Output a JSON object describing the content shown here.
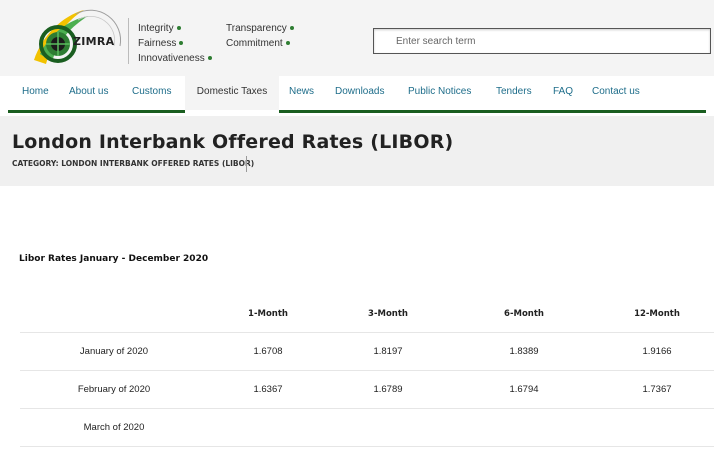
{
  "header": {
    "logo_text": "ZIMRA",
    "values_col1": [
      "Integrity",
      "Fairness",
      "Innovativeness"
    ],
    "values_col2": [
      "Transparency",
      "Commitment"
    ],
    "search_placeholder": "Enter search term",
    "brand_colors": {
      "green": "#2e7d32",
      "dark_green": "#1a5e20",
      "gold": "#f2c200",
      "link_blue": "#1e6d8a"
    }
  },
  "nav": {
    "items": [
      "Home",
      "About us",
      "Customs",
      "Domestic Taxes",
      "News",
      "Downloads",
      "Public Notices",
      "Tenders",
      "FAQ",
      "Contact us"
    ],
    "active": "Domestic Taxes"
  },
  "page": {
    "title": "London Interbank Offered Rates (LIBOR)",
    "category": "CATEGORY: LONDON INTERBANK OFFERED RATES (LIBOR)"
  },
  "content": {
    "heading": "Libor Rates January - December 2020",
    "table": {
      "columns": [
        "",
        "1-Month",
        "3-Month",
        "6-Month",
        "12-Month"
      ],
      "rows": [
        [
          "January of 2020",
          "1.6708",
          "1.8197",
          "1.8389",
          "1.9166"
        ],
        [
          "February of 2020",
          "1.6367",
          "1.6789",
          "1.6794",
          "1.7367"
        ],
        [
          "March of 2020",
          "",
          "",
          "",
          ""
        ]
      ]
    }
  }
}
